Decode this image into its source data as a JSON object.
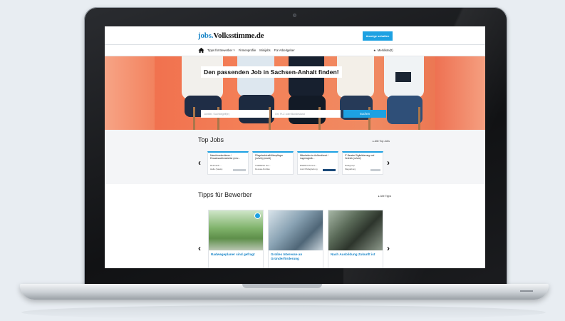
{
  "site": {
    "logo_prefix": "jobs.",
    "logo_name": "Volksstimme.de",
    "cta_label": "Anzeige schalten"
  },
  "nav": {
    "items": [
      "Tipps für Bewerber ˅",
      "Firmenprofile",
      "Minijobs",
      "Für Arbeitgeber"
    ],
    "merkliste": "Merkliste(0)"
  },
  "hero": {
    "headline": "Den passenden Job in Sachsen-Anhalt finden!",
    "search_placeholder": "Jobtitel, Suchbegriff(e)",
    "location_placeholder": "Ort, PLZ oder Bundesland",
    "search_button": "Suchen"
  },
  "top_jobs": {
    "title": "Top Jobs",
    "all_link": "Alle Top Jobs",
    "cards": [
      {
        "title": "Maschinenbediener / Einsatzsachbearbeiter (m/w...",
        "company": "Reinhardt ...",
        "location": "Halle (Saale)"
      },
      {
        "title": "Pflegefachkraft/Altenpfleger (m/w/d) (m/w/d)",
        "company": "THERESA Ger...",
        "location": "Dessau-Roßlau"
      },
      {
        "title": "Mitarbeiter im Außendienst / Lagerlogistik...",
        "company": "ENERCON Ges...",
        "location": "Aurich/Magdeburg"
      },
      {
        "title": "IT-Berater Digitalisierung und Vertrieb (m/w/d)",
        "company": "Datagroup",
        "location": "Magdeburg"
      }
    ]
  },
  "tipps": {
    "title": "Tipps für Bewerber",
    "all_link": "Alle Tipps",
    "cards": [
      {
        "caption": "Radwegeplaner sind gefragt"
      },
      {
        "caption": "Großes Interesse an Gründerförderung"
      },
      {
        "caption": "Nach Ausbildung Zukunft ist"
      }
    ]
  },
  "colors": {
    "accent": "#1da1e2",
    "hero": "#f07a55",
    "link": "#1a86c8"
  }
}
